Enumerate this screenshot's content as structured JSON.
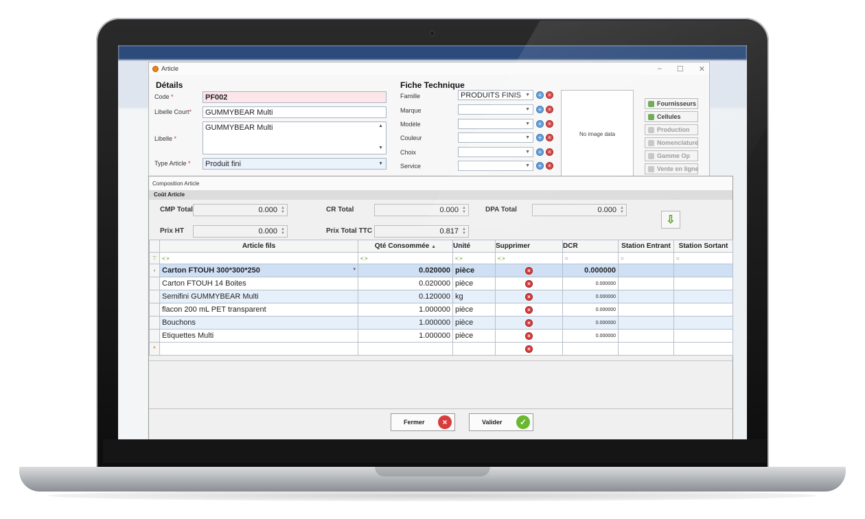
{
  "article": {
    "title": "Article",
    "win_min": "–",
    "win_max": "☐",
    "win_close": "✕",
    "details_title": "Détails",
    "code_label": "Code",
    "code_value": "PF002",
    "libelle_court_label": "Libelle Court",
    "libelle_court_value": "GUMMYBEAR Multi",
    "libelle_label": "Libelle",
    "libelle_value": "GUMMYBEAR Multi",
    "type_label": "Type Article",
    "type_value": "Produit fini",
    "required_mark": "*",
    "fiche_title": "Fiche Technique",
    "fiche_fields": [
      {
        "label": "Famille",
        "value": "PRODUITS FINIS"
      },
      {
        "label": "Marque",
        "value": ""
      },
      {
        "label": "Modèle",
        "value": ""
      },
      {
        "label": "Couleur",
        "value": ""
      },
      {
        "label": "Choix",
        "value": ""
      },
      {
        "label": "Service",
        "value": ""
      }
    ],
    "no_image": "No image data",
    "side_buttons": [
      {
        "label": "Fournisseurs",
        "enabled": true,
        "icon": "users-icon"
      },
      {
        "label": "Cellules",
        "enabled": true,
        "icon": "chart-icon"
      },
      {
        "label": "Production",
        "enabled": false,
        "icon": "production-icon"
      },
      {
        "label": "Nomenclature",
        "enabled": false,
        "icon": "list-icon"
      },
      {
        "label": "Gamme Op",
        "enabled": false,
        "icon": "gamme-icon"
      },
      {
        "label": "Vente en ligne",
        "enabled": false,
        "icon": "cart-icon"
      }
    ]
  },
  "composition": {
    "title": "Composition Article",
    "cout_header": "Coût Article",
    "cmp_label": "CMP Total",
    "cmp_value": "0.000",
    "cr_label": "CR Total",
    "cr_value": "0.000",
    "dpa_label": "DPA Total",
    "dpa_value": "0.000",
    "prix_ht_label": "Prix HT",
    "prix_ht_value": "0.000",
    "prix_ttc_label": "Prix Total TTC",
    "prix_ttc_value": "0.817",
    "columns": [
      "Article fils",
      "Qté Consommée",
      "Unité",
      "Supprimer",
      "DCR",
      "Station Entrant",
      "Station Sortant"
    ],
    "rows": [
      {
        "article": "Carton FTOUH 300*300*250",
        "qte": "0.020000",
        "unite": "pièce",
        "dcr": "0.000000"
      },
      {
        "article": "Carton FTOUH 14 Boites",
        "qte": "0.020000",
        "unite": "pièce",
        "dcr": "0.000000"
      },
      {
        "article": "Semifini GUMMYBEAR Multi",
        "qte": "0.120000",
        "unite": "kg",
        "dcr": "0.000000"
      },
      {
        "article": "flacon 200 mL PET transparent",
        "qte": "1.000000",
        "unite": "pièce",
        "dcr": "0.000000"
      },
      {
        "article": "Bouchons",
        "qte": "1.000000",
        "unite": "pièce",
        "dcr": "0.000000"
      },
      {
        "article": "Etiquettes Multi",
        "qte": "1.000000",
        "unite": "pièce",
        "dcr": "0.000000"
      }
    ],
    "fermer_label": "Fermer",
    "valider_label": "Valider"
  },
  "colors": {
    "accent_blue": "#cfe0f5",
    "delete_red": "#d93c3c",
    "confirm_green": "#6ab82f"
  }
}
